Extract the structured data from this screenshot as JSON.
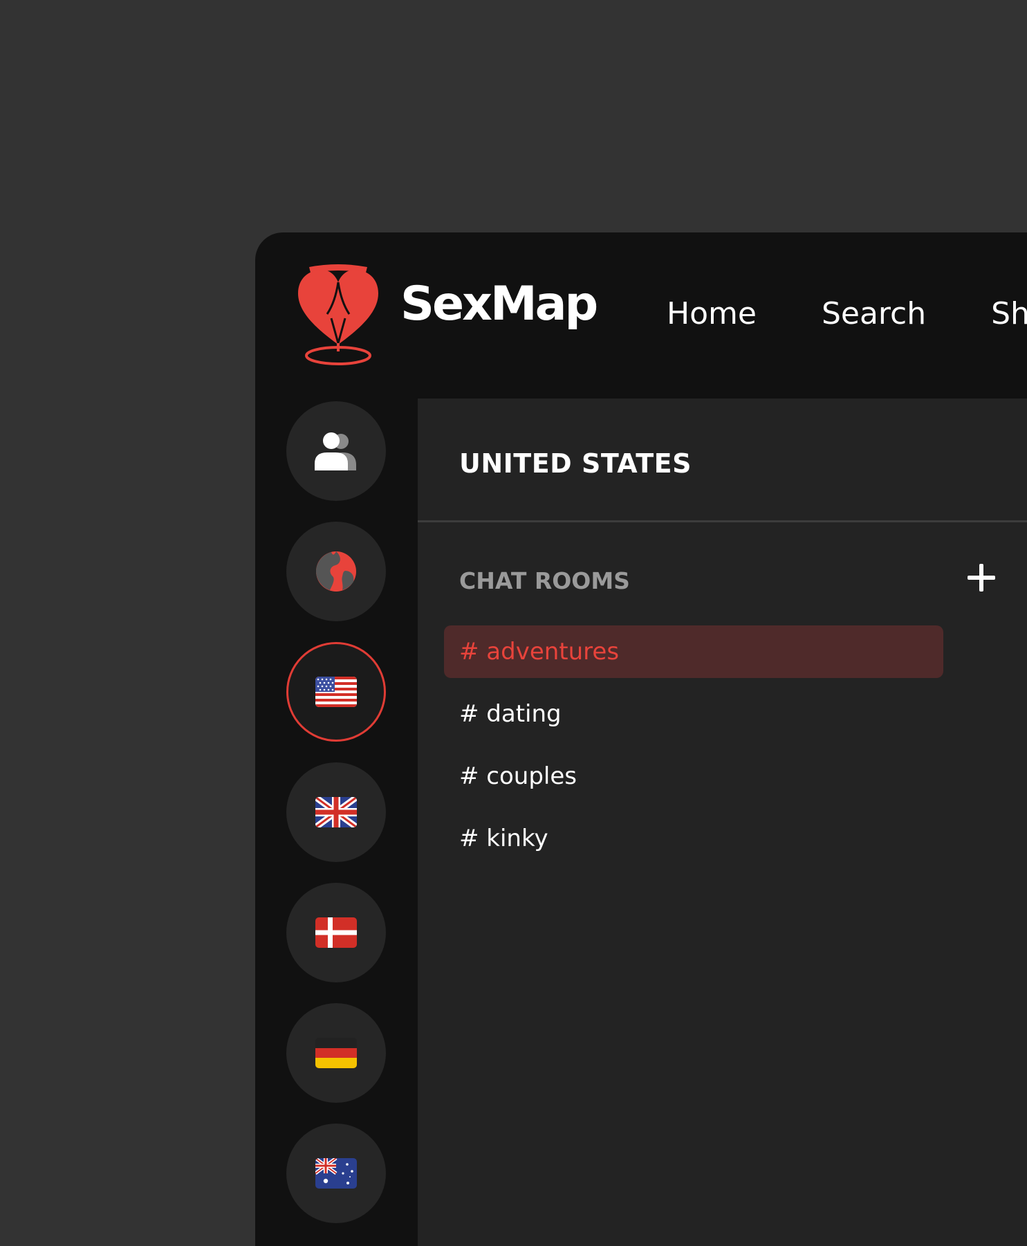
{
  "brand": {
    "name": "SexMap",
    "accent_color": "#e8433b",
    "logo_icon": "heart-pin-icon"
  },
  "nav": {
    "items": [
      "Home",
      "Search",
      "Sh"
    ]
  },
  "rail": {
    "items": [
      {
        "icon": "users-icon",
        "active": false
      },
      {
        "icon": "globe-icon",
        "active": false
      },
      {
        "icon": "us-flag-icon",
        "active": true
      },
      {
        "icon": "uk-flag-icon",
        "active": false
      },
      {
        "icon": "denmark-flag-icon",
        "active": false
      },
      {
        "icon": "germany-flag-icon",
        "active": false
      },
      {
        "icon": "australia-flag-icon",
        "active": false
      }
    ]
  },
  "panel": {
    "title": "UNITED STATES",
    "rooms_heading": "CHAT ROOMS",
    "add_icon": "plus-icon",
    "rooms": [
      {
        "label": "# adventures",
        "active": true
      },
      {
        "label": "# dating",
        "active": false
      },
      {
        "label": "# couples",
        "active": false
      },
      {
        "label": "# kinky",
        "active": false
      }
    ]
  }
}
